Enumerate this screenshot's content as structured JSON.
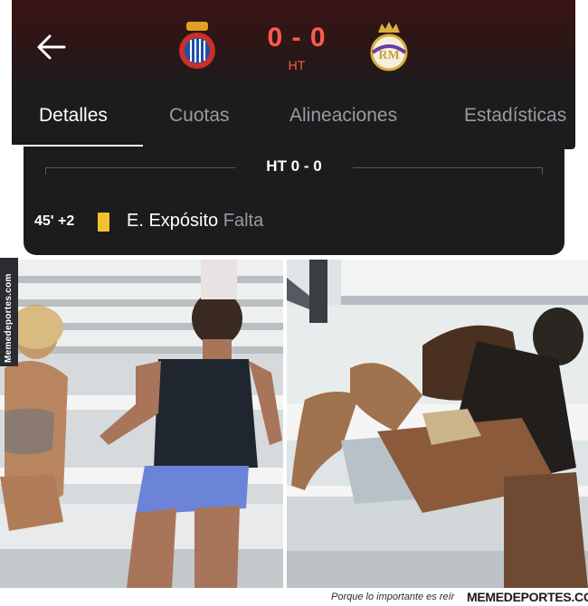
{
  "header": {
    "back_icon": "arrow-left-icon",
    "home_crest": "espanyol-crest-icon",
    "away_crest": "real-madrid-crest-icon",
    "score": "0 - 0",
    "period": "HT",
    "score_color": "#ff5a4e"
  },
  "tabs": [
    {
      "label": "Detalles",
      "active": true
    },
    {
      "label": "Cuotas",
      "active": false
    },
    {
      "label": "Alineaciones",
      "active": false
    },
    {
      "label": "Estadísticas",
      "active": false
    }
  ],
  "events": {
    "divider_label": "HT 0 - 0",
    "items": [
      {
        "minute": "45' +2",
        "card": "yellow-card-icon",
        "player": "E. Expósito",
        "type": "Falta"
      }
    ]
  },
  "watermark": {
    "side": "Memedeportes.com",
    "tagline": "Porque lo importante es reír",
    "brand": "MEMEDEPORTES.COM"
  },
  "colors": {
    "app_bg": "#1c1c1f",
    "header_gradient_top": "#3a1414",
    "yellow_card": "#f2c230",
    "inactive_tab": "#9b9b9f"
  }
}
